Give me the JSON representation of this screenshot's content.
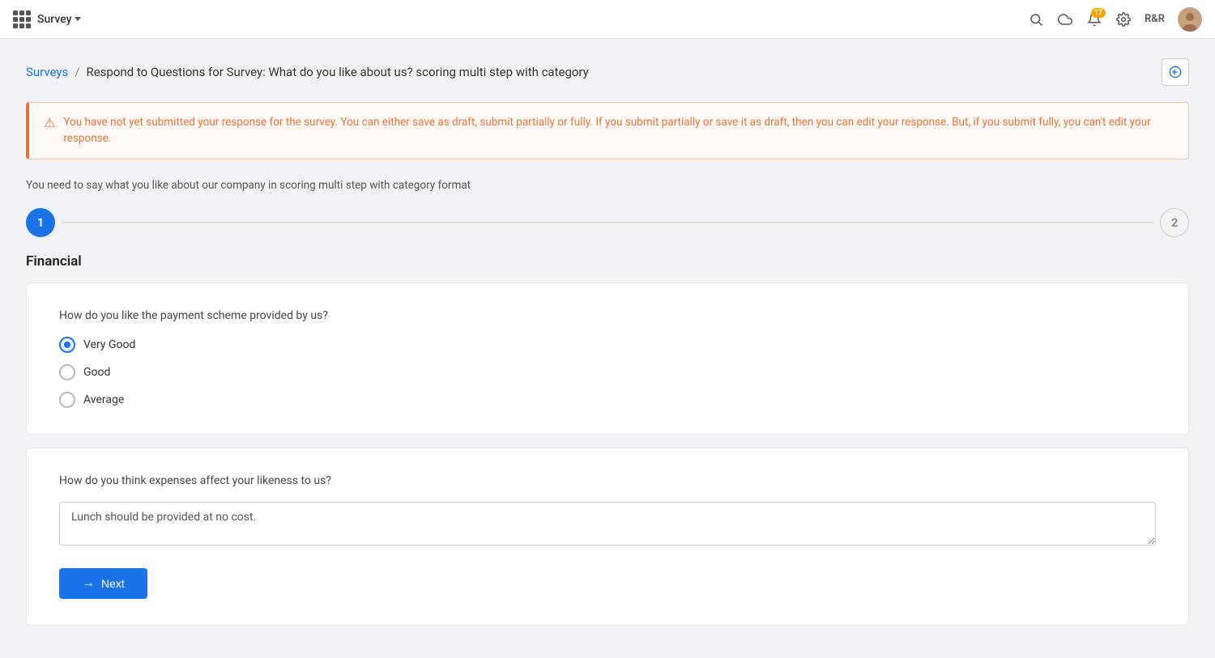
{
  "topbar": {
    "app_name": "Survey",
    "chevron": "▾",
    "icons": {
      "search": "🔍",
      "cloud": "☁",
      "notifications": "🔔",
      "settings": "⚙"
    },
    "notification_badge": "17",
    "user_initials": "R&R"
  },
  "breadcrumb": {
    "link_label": "Surveys",
    "separator": "/",
    "current": "Respond to Questions for Survey: What do you like about us? scoring multi step with category"
  },
  "warning": {
    "text": "You have not yet submitted your response for the survey. You can either save as draft, submit partially or fully. If you submit partially or save it as draft, then you can edit your response. But, if you submit fully, you can't edit your response."
  },
  "survey": {
    "description": "You need to say what you like about our company in scoring multi step with category format",
    "steps": [
      {
        "number": "1",
        "active": true
      },
      {
        "number": "2",
        "active": false
      }
    ],
    "section_title": "Financial",
    "questions": [
      {
        "id": "q1",
        "label": "How do you like the payment scheme provided by us?",
        "type": "radio",
        "options": [
          {
            "value": "very_good",
            "label": "Very Good",
            "checked": true
          },
          {
            "value": "good",
            "label": "Good",
            "checked": false
          },
          {
            "value": "average",
            "label": "Average",
            "checked": false
          }
        ]
      },
      {
        "id": "q2",
        "label": "How do you think expenses affect your likeness to us?",
        "type": "textarea",
        "value": "Lunch should be provided at no cost.",
        "placeholder": ""
      }
    ],
    "next_button_label": "Next"
  }
}
